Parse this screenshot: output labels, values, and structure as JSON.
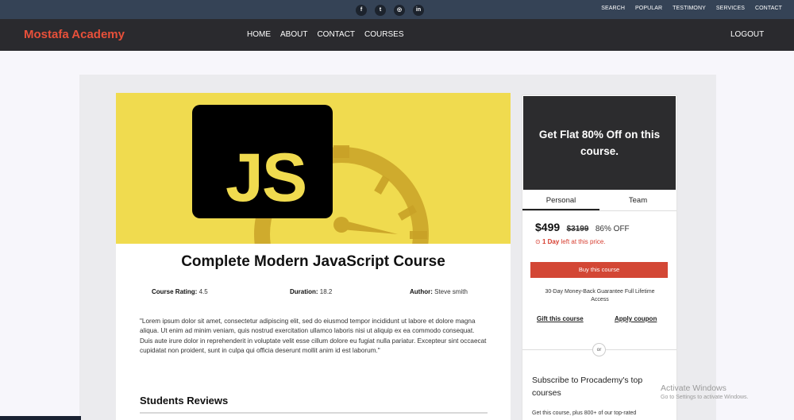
{
  "topbar": {
    "social": [
      {
        "glyph": "f",
        "icon": "facebook-icon"
      },
      {
        "glyph": "t",
        "icon": "twitter-icon"
      },
      {
        "glyph": "◎",
        "icon": "instagram-icon"
      },
      {
        "glyph": "in",
        "icon": "linkedin-icon"
      }
    ],
    "links": [
      "SEARCH",
      "POPULAR",
      "TESTIMONY",
      "SERVICES",
      "CONTACT"
    ]
  },
  "nav": {
    "brand": "Mostafa Academy",
    "links": [
      "HOME",
      "ABOUT",
      "CONTACT",
      "COURSES"
    ],
    "logout": "LOGOUT"
  },
  "course": {
    "hero_text": "JS",
    "title": "Complete Modern JavaScript Course",
    "rating_label": "Course Rating:",
    "rating_value": "4.5",
    "duration_label": "Duration:",
    "duration_value": "18.2",
    "author_label": "Author:",
    "author_value": "Steve smith",
    "description": "\"Lorem ipsum dolor sit amet, consectetur adipiscing elit, sed do eiusmod tempor incididunt ut labore et dolore magna aliqua. Ut enim ad minim veniam, quis nostrud exercitation ullamco laboris nisi ut aliquip ex ea commodo consequat. Duis aute irure dolor in reprehenderit in voluptate velit esse cillum dolore eu fugiat nulla pariatur. Excepteur sint occaecat cupidatat non proident, sunt in culpa qui officia deserunt mollit anim id est laborum.\"",
    "reviews_title": "Students Reviews"
  },
  "sidebar": {
    "promo": "Get Flat 80% Off on this course.",
    "tabs": [
      "Personal",
      "Team"
    ],
    "price_now": "$499",
    "price_old": "$3199",
    "discount": "86% OFF",
    "urgency_bold": "1 Day",
    "urgency_rest": " left at this price.",
    "buy_label": "Buy this course",
    "guarantee": "30-Day Money-Back Guarantee Full Lifetime Access",
    "gift_label": "Gift this course",
    "coupon_label": "Apply coupon",
    "or_label": "or",
    "subscribe_title": "Subscribe to Procademy's top courses",
    "subscribe_text": "Get this course, plus 800+ of our top-rated"
  },
  "watermark": {
    "line1": "Activate Windows",
    "line2": "Go to Settings to activate Windows."
  },
  "colors": {
    "brand": "#e8503a",
    "hero_bg": "#f0db4f",
    "buy_button": "#d34735"
  }
}
